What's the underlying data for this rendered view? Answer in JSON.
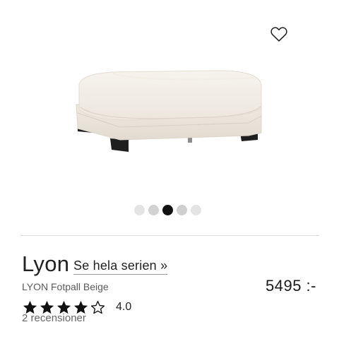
{
  "product": {
    "name": "Lyon",
    "series_link": "Se hela serien »",
    "subtitle": "LYON Fotpall Beige",
    "price": "5495 :-"
  },
  "image": {
    "icon": "ottoman-photo",
    "color": "#efeae3"
  },
  "wishlist": {
    "icon": "heart-outline-icon"
  },
  "carousel": {
    "count": 5,
    "active_index": 2,
    "active_color": "#111111",
    "inactive_color": "#dcdcdc"
  },
  "rating": {
    "value": "4.0",
    "stars": 4,
    "max_stars": 5,
    "reviews": "2 recensioner"
  }
}
